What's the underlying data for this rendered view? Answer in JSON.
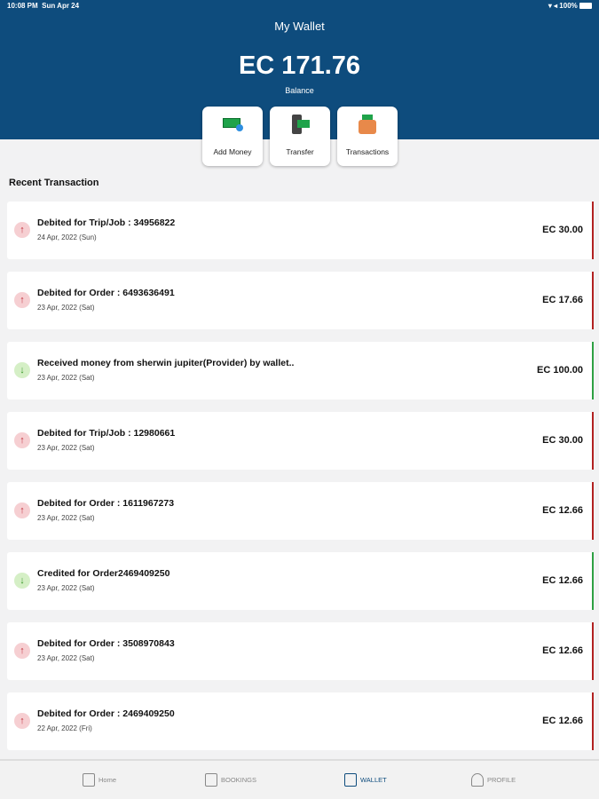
{
  "status": {
    "time": "10:08 PM",
    "date": "Sun Apr 24",
    "battery": "100%"
  },
  "header": {
    "title": "My Wallet",
    "balance": "EC 171.76",
    "balance_label": "Balance"
  },
  "actions": [
    {
      "label": "Add Money"
    },
    {
      "label": "Transfer"
    },
    {
      "label": "Transactions"
    }
  ],
  "section_title": "Recent Transaction",
  "transactions": [
    {
      "type": "debit",
      "desc": "Debited for Trip/Job : 34956822",
      "date": "24 Apr, 2022 (Sun)",
      "amount": "EC 30.00"
    },
    {
      "type": "debit",
      "desc": "Debited for Order : 6493636491",
      "date": "23 Apr, 2022 (Sat)",
      "amount": "EC 17.66"
    },
    {
      "type": "credit",
      "desc": "Received money from sherwin jupiter(Provider)  by wallet..",
      "date": "23 Apr, 2022 (Sat)",
      "amount": "EC 100.00"
    },
    {
      "type": "debit",
      "desc": "Debited for Trip/Job : 12980661",
      "date": "23 Apr, 2022 (Sat)",
      "amount": "EC 30.00"
    },
    {
      "type": "debit",
      "desc": "Debited for Order : 1611967273",
      "date": "23 Apr, 2022 (Sat)",
      "amount": "EC 12.66"
    },
    {
      "type": "credit",
      "desc": "Credited for Order2469409250",
      "date": "23 Apr, 2022 (Sat)",
      "amount": "EC 12.66"
    },
    {
      "type": "debit",
      "desc": "Debited for Order : 3508970843",
      "date": "23 Apr, 2022 (Sat)",
      "amount": "EC 12.66"
    },
    {
      "type": "debit",
      "desc": "Debited for Order : 2469409250",
      "date": "22 Apr, 2022 (Fri)",
      "amount": "EC 12.66"
    }
  ],
  "nav": [
    {
      "label": "Home"
    },
    {
      "label": "BOOKINGS"
    },
    {
      "label": "WALLET"
    },
    {
      "label": "PROFILE"
    }
  ],
  "colors": {
    "primary": "#0e4c7d",
    "debit": "#b22222",
    "credit": "#2ea043"
  }
}
